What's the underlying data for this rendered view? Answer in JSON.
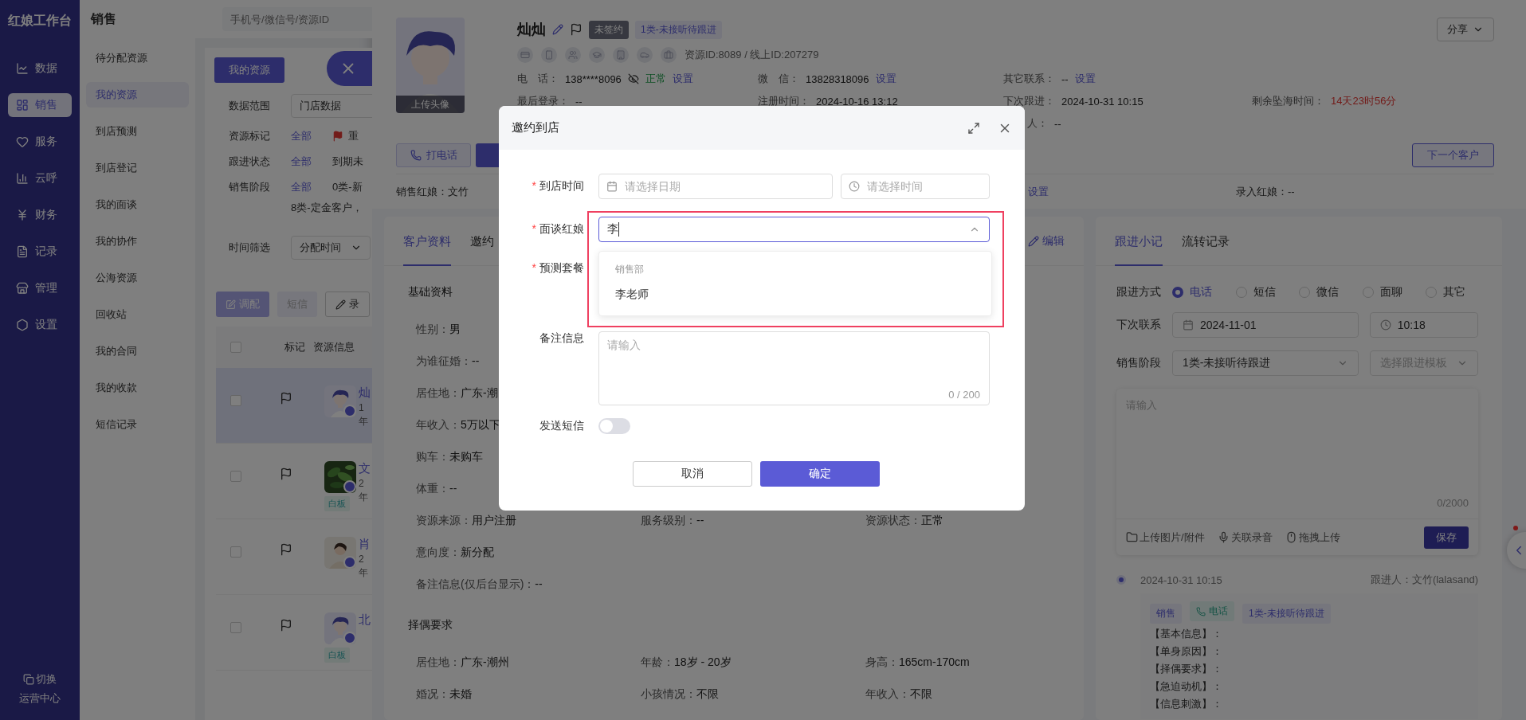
{
  "app": {
    "title": "红娘工作台",
    "switch_label": "切换",
    "switch_target": "运营中心"
  },
  "nav": [
    {
      "label": "数据",
      "selected": false
    },
    {
      "label": "销售",
      "selected": true
    },
    {
      "label": "服务",
      "selected": false
    },
    {
      "label": "云呼",
      "selected": false
    },
    {
      "label": "财务",
      "selected": false
    },
    {
      "label": "记录",
      "selected": false
    },
    {
      "label": "管理",
      "selected": false
    },
    {
      "label": "设置",
      "selected": false
    }
  ],
  "subnav": {
    "title": "销售",
    "items": [
      {
        "label": "待分配资源",
        "selected": false
      },
      {
        "label": "我的资源",
        "selected": true
      },
      {
        "label": "到店预测",
        "selected": false
      },
      {
        "label": "到店登记",
        "selected": false
      },
      {
        "label": "我的面谈",
        "selected": false
      },
      {
        "label": "我的协作",
        "selected": false
      },
      {
        "label": "公海资源",
        "selected": false
      },
      {
        "label": "回收站",
        "selected": false
      },
      {
        "label": "我的合同",
        "selected": false
      },
      {
        "label": "我的收款",
        "selected": false
      },
      {
        "label": "短信记录",
        "selected": false
      }
    ]
  },
  "list": {
    "search_placeholder": "手机号/微信号/资源ID",
    "tab": "我的资源",
    "filters": [
      {
        "kind": "select",
        "label": "数据范围",
        "value": "门店数据"
      },
      {
        "kind": "options",
        "label": "资源标记",
        "options": [
          {
            "text": "全部",
            "selected": true,
            "flag": false
          },
          {
            "text": "重",
            "selected": false,
            "flag": true
          }
        ]
      },
      {
        "kind": "options",
        "label": "跟进状态",
        "options": [
          {
            "text": "全部",
            "selected": true,
            "flag": false
          },
          {
            "text": "到期未",
            "selected": false,
            "flag": false
          }
        ]
      },
      {
        "kind": "options",
        "label": "销售阶段",
        "options": [
          {
            "text": "全部",
            "selected": true,
            "flag": false
          },
          {
            "text": "0类-新",
            "selected": false,
            "flag": false
          }
        ],
        "more": "8类-定金客户，"
      },
      {
        "kind": "select",
        "label": "时间筛选",
        "value": "分配时间"
      }
    ],
    "actions": [
      {
        "label": "调配",
        "kind": "primary"
      },
      {
        "label": "短信",
        "kind": "light"
      },
      {
        "label": "录",
        "kind": "outline"
      }
    ],
    "header_checked": false,
    "columns": [
      "标记",
      "资源信息"
    ],
    "rows": [
      {
        "name": "灿",
        "line_1": "1",
        "line_2": "年",
        "selected": true,
        "checked": false
      },
      {
        "name": "文",
        "line_1": "2",
        "line_2": "年",
        "tag": "白板",
        "selected": false,
        "checked": false
      },
      {
        "name": "肖",
        "line_1": "2",
        "line_2": "年",
        "selected": false,
        "checked": false
      },
      {
        "name": "北",
        "tag": "白板",
        "selected": false,
        "checked": false
      }
    ]
  },
  "customer": {
    "name": "灿灿",
    "avatar_label": "上传头像",
    "status_tag": "未签约",
    "stage_tag": "1类-未接听待跟进",
    "ids": "资源ID:8089 / 线上ID:207279",
    "share": "分享",
    "info_rows": [
      [
        {
          "label": "电　话：",
          "value": "138****8096",
          "status": "正常",
          "action": "设置"
        },
        {
          "label": "微　信：",
          "value": "13828318096",
          "action": "设置"
        },
        {
          "label": "其它联系：",
          "value": "--",
          "action": "设置"
        }
      ],
      [
        {
          "label": "最后登录：",
          "value": "--"
        },
        {
          "label": "注册时间：",
          "value": "2024-10-16 13:12"
        },
        {
          "label": "下次跟进：",
          "value": "2024-10-31 10:15"
        },
        {
          "label": "剩余坠海时间：",
          "value": "14天23时56分",
          "alert": true
        }
      ],
      [
        {
          "label": "人：",
          "value": "--",
          "partial": true
        }
      ]
    ],
    "call_button": "打电话",
    "next_button": "下一个客户",
    "sales_label": "销售红娘：",
    "sales_value": "文竹",
    "sales_action": "设置",
    "entry_label": "录入红娘：",
    "entry_value": "--"
  },
  "profile": {
    "tabs": [
      {
        "label": "客户资料",
        "selected": true
      },
      {
        "label": "邀约",
        "selected": false
      }
    ],
    "edit": "编辑",
    "sections": [
      {
        "title": "基础资料",
        "fields": [
          [
            {
              "label": "性别：",
              "value": "男"
            }
          ],
          [
            {
              "label": "为谁征婚：",
              "value": "--"
            }
          ],
          [
            {
              "label": "居住地：",
              "value": "广东-潮"
            }
          ],
          [
            {
              "label": "年收入：",
              "value": "5万以下"
            }
          ],
          [
            {
              "label": "购车：",
              "value": "未购车"
            }
          ],
          [
            {
              "label": "体重：",
              "value": "--"
            }
          ],
          [
            {
              "label": "资源来源：",
              "value": "用户注册"
            },
            {
              "label": "服务级别：",
              "value": "--"
            },
            {
              "label": "资源状态：",
              "value": "正常"
            }
          ],
          [
            {
              "label": "意向度：",
              "value": "新分配"
            }
          ],
          [
            {
              "label": "备注信息(仅后台显示)：",
              "value": "--"
            }
          ]
        ]
      },
      {
        "title": "择偶要求",
        "fields": [
          [
            {
              "label": "居住地：",
              "value": "广东-潮州"
            },
            {
              "label": "年龄：",
              "value": "18岁 - 20岁"
            },
            {
              "label": "身高：",
              "value": "165cm-170cm"
            }
          ],
          [
            {
              "label": "婚况：",
              "value": "未婚"
            },
            {
              "label": "小孩情况：",
              "value": "不限"
            },
            {
              "label": "年收入：",
              "value": "不限"
            }
          ]
        ]
      }
    ]
  },
  "followup": {
    "tabs": [
      {
        "label": "跟进小记",
        "selected": true
      },
      {
        "label": "流转记录",
        "selected": false
      }
    ],
    "method_label": "跟进方式",
    "methods": [
      {
        "label": "电话",
        "selected": true
      },
      {
        "label": "短信",
        "selected": false
      },
      {
        "label": "微信",
        "selected": false
      },
      {
        "label": "面聊",
        "selected": false
      },
      {
        "label": "其它",
        "selected": false
      }
    ],
    "next_label": "下次联系",
    "next_date": "2024-11-01",
    "next_time": "10:18",
    "stage_label": "销售阶段",
    "stage_value": "1类-未接听待跟进",
    "template_placeholder": "选择跟进模板",
    "note_placeholder": "请输入",
    "note_count": "0/2000",
    "tools": [
      {
        "kind": "folder",
        "label": "上传图片/附件"
      },
      {
        "kind": "mic",
        "label": "关联录音"
      },
      {
        "kind": "mouse",
        "label": "拖拽上传"
      }
    ],
    "save": "保存",
    "entry": {
      "time": "2024-10-31 10:15",
      "by_label": "跟进人：",
      "by_value": "文竹(lalasand)",
      "tags": [
        {
          "kind": "plain",
          "label": "销售"
        },
        {
          "kind": "phone",
          "label": "电话"
        },
        {
          "kind": "plain",
          "label": "1类-未接听待跟进"
        }
      ],
      "lines": [
        "【基本信息】：",
        "【单身原因】：",
        "【择偶要求】：",
        "【急迫动机】：",
        "【信息刺激】："
      ]
    }
  },
  "dialog": {
    "title": "邀约到店",
    "required_mark": "*",
    "rows": [
      {
        "kind": "datetime",
        "label": "到店时间",
        "required": true,
        "date_placeholder": "请选择日期",
        "time_placeholder": "请选择时间"
      },
      {
        "kind": "search",
        "label": "面谈红娘",
        "required": true,
        "value": "李",
        "open": true,
        "group": "销售部",
        "options": [
          "李老师"
        ]
      },
      {
        "kind": "covered",
        "label": "预测套餐",
        "required": true
      },
      {
        "kind": "textarea",
        "label": "备注信息",
        "required": false,
        "placeholder": "请输入",
        "count": "0 / 200"
      },
      {
        "kind": "switch",
        "label": "发送短信",
        "required": false,
        "on": false
      }
    ],
    "cancel": "取消",
    "confirm": "确定"
  }
}
